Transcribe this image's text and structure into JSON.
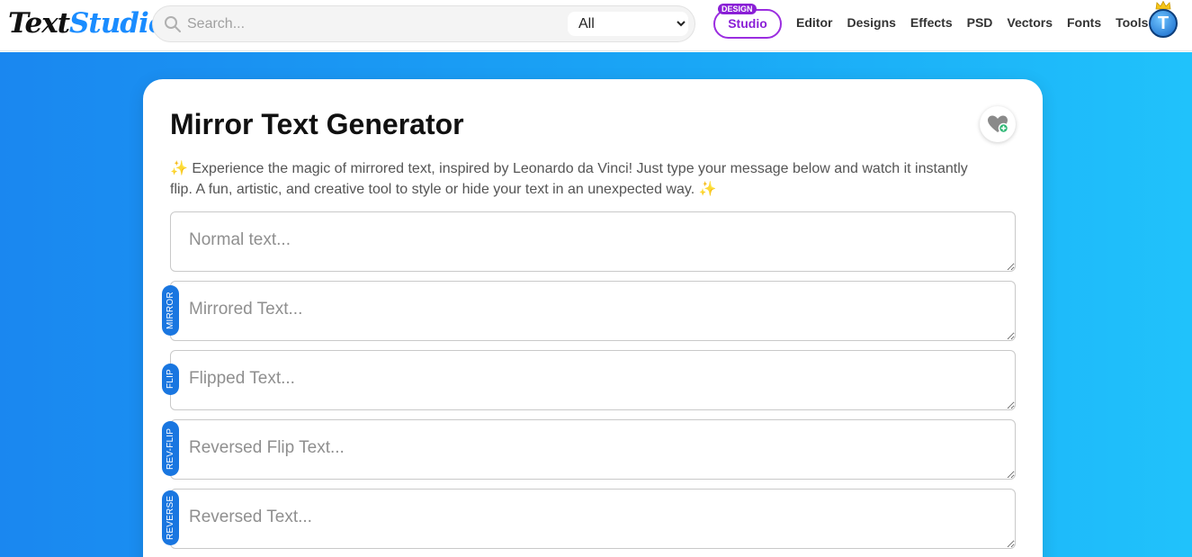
{
  "header": {
    "logo_part1": "Text",
    "logo_part2": "Studio",
    "search_placeholder": "Search...",
    "category_selected": "All",
    "studio_badge": "DESIGN",
    "studio_label": "Studio",
    "nav": [
      "Editor",
      "Designs",
      "Effects",
      "PSD",
      "Vectors",
      "Fonts",
      "Tools"
    ],
    "avatar_letter": "T"
  },
  "main": {
    "title": "Mirror Text Generator",
    "description": "✨ Experience the magic of mirrored text, inspired by Leonardo da Vinci! Just type your message below and watch it instantly flip. A fun, artistic, and creative tool to style or hide your text in an unexpected way. ✨",
    "fields": [
      {
        "tag": "",
        "placeholder": "Normal text..."
      },
      {
        "tag": "MIRROR",
        "placeholder": "Mirrored Text..."
      },
      {
        "tag": "FLIP",
        "placeholder": "Flipped Text..."
      },
      {
        "tag": "REV-FLIP",
        "placeholder": "Reversed Flip Text..."
      },
      {
        "tag": "REVERSE",
        "placeholder": "Reversed Text..."
      }
    ]
  },
  "colors": {
    "accent": "#1976e0",
    "studio_purple": "#8a1fd6",
    "gradient_start": "#1a87f0",
    "gradient_end": "#20c2fb"
  }
}
